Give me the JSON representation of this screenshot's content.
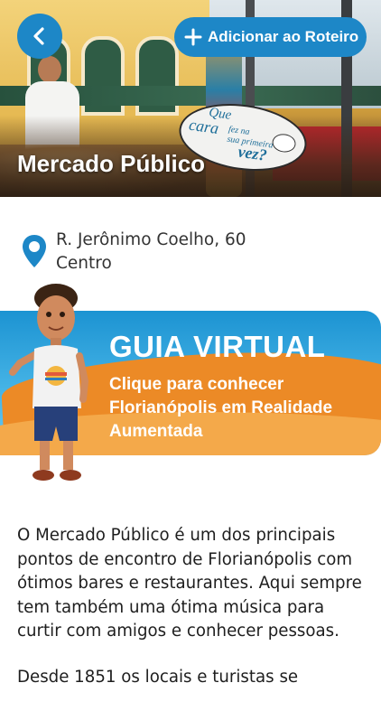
{
  "header": {
    "back_icon": "chevron-left-icon",
    "add_button_label": "Adicionar ao Roteiro",
    "add_icon": "plus-icon",
    "place_title": "Mercado Público",
    "hero_bubble": {
      "line1": "Que",
      "line2": "cara",
      "line3a": "fez na",
      "line3b": "sua primeira",
      "line4": "vez?"
    }
  },
  "address": {
    "icon": "location-pin-icon",
    "street": "R. Jerônimo Coelho, 60",
    "district": "Centro"
  },
  "banner": {
    "title": "GUIA VIRTUAL",
    "subtitle": "Clique para conhecer Florianópolis em Realidade Aumentada"
  },
  "description": {
    "paragraphs": [
      "O Mercado Público é um dos principais pontos de encontro de Florianópolis com ótimos bares e restaurantes. Aqui sempre tem também uma ótima música para curtir com amigos e conhecer pessoas.",
      "Desde 1851 os locais e turistas se"
    ]
  },
  "colors": {
    "accent": "#1d87c7",
    "banner_sky": "#1c93d2",
    "banner_sand": "#ec8a26",
    "text": "#1e1e1e"
  }
}
